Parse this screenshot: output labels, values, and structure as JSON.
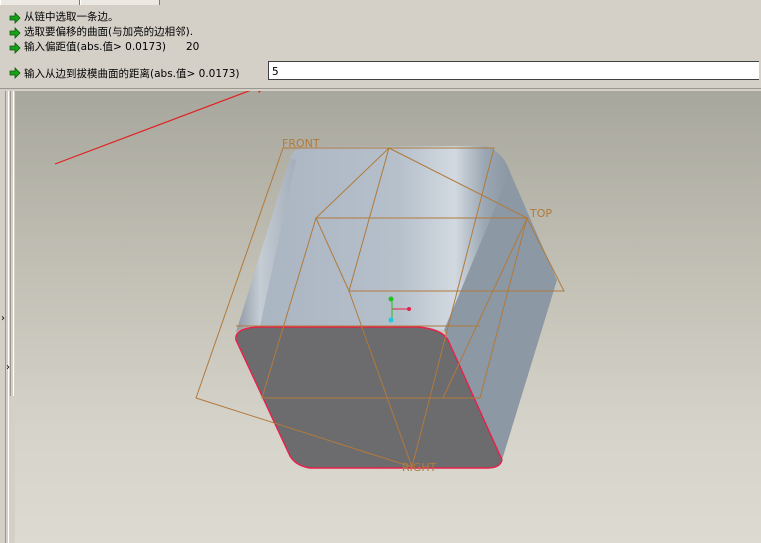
{
  "message_log": {
    "lines": [
      {
        "text": "从链中选取一条边。",
        "value": ""
      },
      {
        "text": "选取要偏移的曲面(与加亮的边相邻).",
        "value": ""
      },
      {
        "text": "输入偏距值(abs.值> 0.0173)",
        "value": "20"
      }
    ]
  },
  "prompt": {
    "label": "输入从边到拔模曲面的距离(abs.值> 0.0173)",
    "input_value": "5"
  },
  "datum_planes": {
    "front": "FRONT",
    "top": "TOP",
    "right": "RIGHT"
  },
  "colors": {
    "datum_plane": "#b07a3c",
    "highlight_edge": "#e8204a",
    "annotation_arrow": "#e02020",
    "message_arrow": "#18a018"
  },
  "icons": {
    "message_arrow": "green-arrow-icon",
    "coordinate_triad": "csys-triad-icon"
  }
}
